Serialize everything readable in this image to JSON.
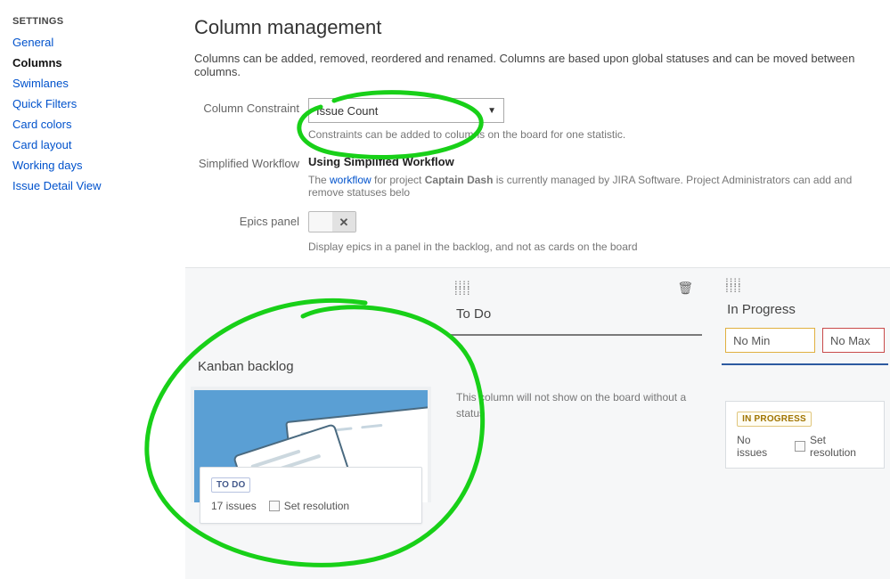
{
  "sidebar": {
    "title": "SETTINGS",
    "items": [
      {
        "label": "General"
      },
      {
        "label": "Columns"
      },
      {
        "label": "Swimlanes"
      },
      {
        "label": "Quick Filters"
      },
      {
        "label": "Card colors"
      },
      {
        "label": "Card layout"
      },
      {
        "label": "Working days"
      },
      {
        "label": "Issue Detail View"
      }
    ],
    "active_index": 1
  },
  "page": {
    "title": "Column management",
    "description": "Columns can be added, removed, reordered and renamed. Columns are based upon global statuses and can be moved between columns."
  },
  "constraint": {
    "label": "Column Constraint",
    "value": "Issue Count",
    "hint": "Constraints can be added to columns on the board for one statistic."
  },
  "workflow": {
    "label": "Simplified Workflow",
    "status": "Using Simplified Workflow",
    "hint_pre": "The ",
    "hint_link": "workflow",
    "hint_mid": " for project ",
    "project": "Captain Dash",
    "hint_post": " is currently managed by JIRA Software. Project Administrators can add and remove statuses belo"
  },
  "epics": {
    "label": "Epics panel",
    "hint": "Display epics in a panel in the backlog, and not as cards on the board"
  },
  "backlog": {
    "title": "Kanban backlog",
    "badge": "TO DO",
    "issues": "17 issues",
    "set_resolution": "Set resolution"
  },
  "todo": {
    "title": "To Do",
    "hint": "This column will not show on the board without a status"
  },
  "inprogress": {
    "title": "In Progress",
    "min_placeholder": "No Min",
    "max_placeholder": "No Max",
    "badge": "IN PROGRESS",
    "issues": "No issues",
    "set_resolution": "Set resolution"
  }
}
